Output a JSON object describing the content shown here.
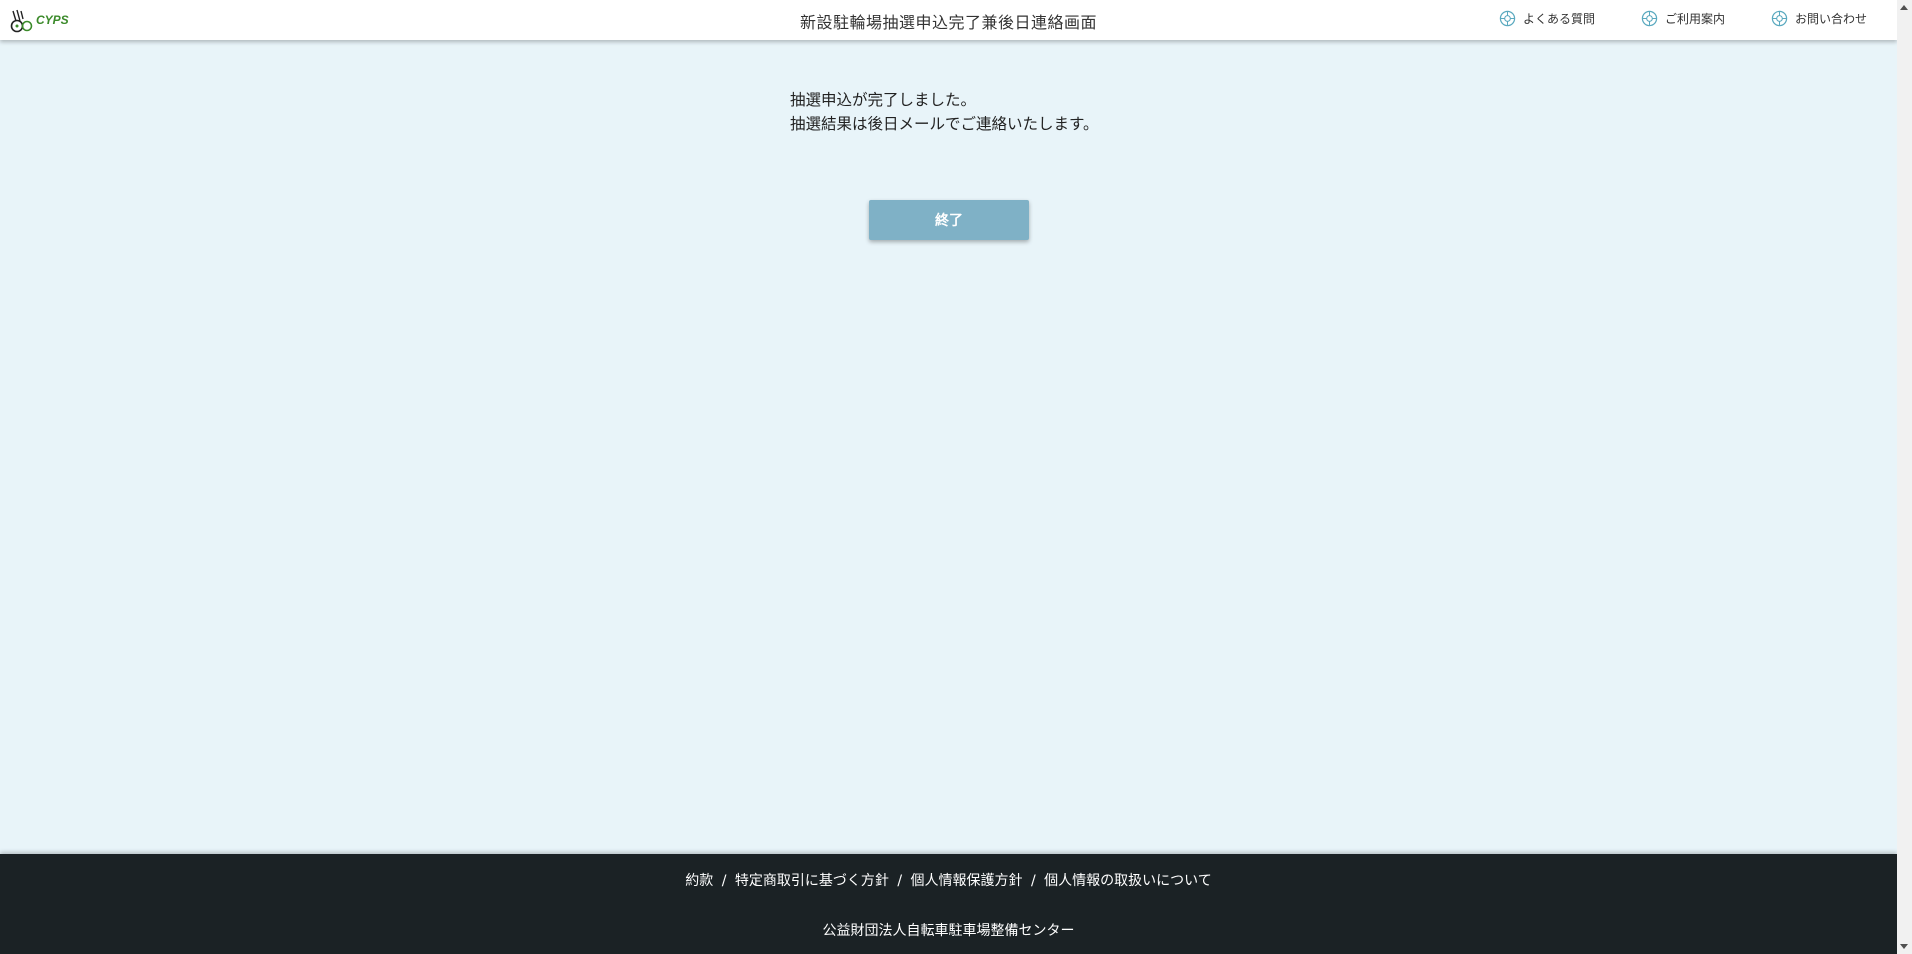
{
  "header": {
    "logo_text": "CYPS",
    "title": "新設駐輪場抽選申込完了兼後日連絡画面",
    "nav": [
      {
        "label": "よくある質問",
        "icon": "help-circle-icon"
      },
      {
        "label": "ご利用案内",
        "icon": "help-circle-icon"
      },
      {
        "label": "お問い合わせ",
        "icon": "help-circle-icon"
      }
    ]
  },
  "main": {
    "message_line1": "抽選申込が完了しました。",
    "message_line2": "抽選結果は後日メールでご連絡いたします。",
    "finish_button_label": "終了"
  },
  "footer": {
    "links": [
      {
        "label": "約款"
      },
      {
        "label": "特定商取引に基づく方針"
      },
      {
        "label": "個人情報保護方針"
      },
      {
        "label": "個人情報の取扱いについて"
      }
    ],
    "separator": "/",
    "organization": "公益財団法人自転車駐車場整備センター"
  },
  "colors": {
    "background": "#e8f4f9",
    "button": "#7fb1c6",
    "footer": "#1b2225",
    "logo_green": "#3b8a2a",
    "icon_teal": "#5aa9bf"
  }
}
